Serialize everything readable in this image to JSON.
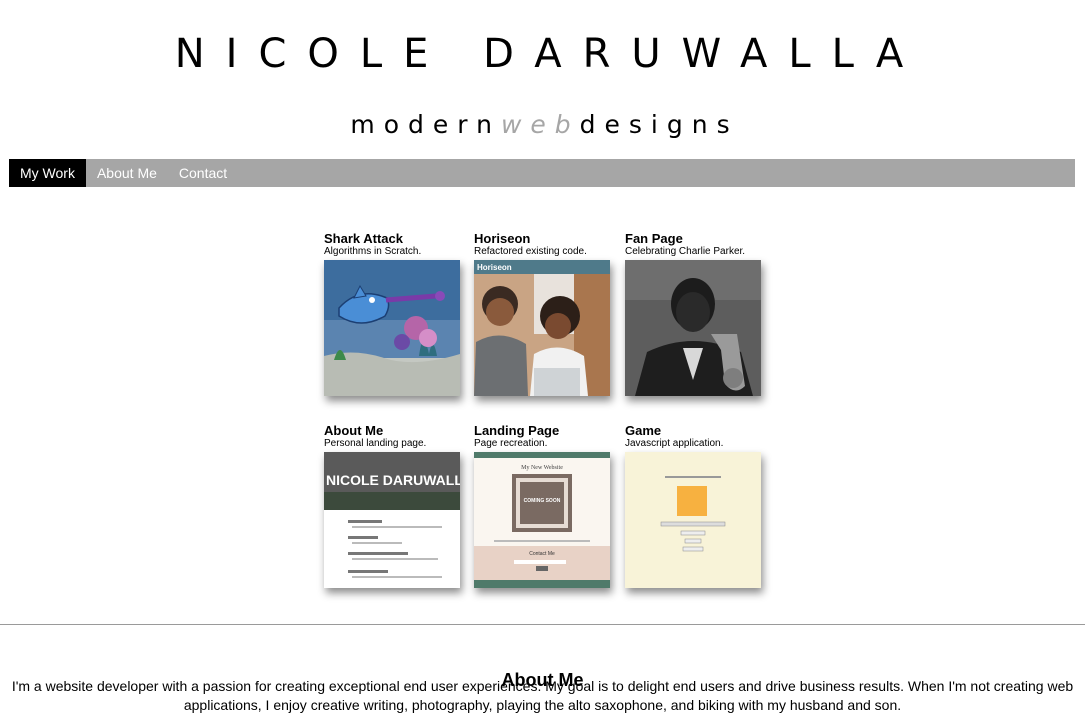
{
  "header": {
    "name": "NICOLE DARUWALLA",
    "tagline_part1": "modern",
    "tagline_part2": "web",
    "tagline_part3": "designs"
  },
  "nav": {
    "items": [
      {
        "label": "My Work",
        "active": true
      },
      {
        "label": "About Me",
        "active": false
      },
      {
        "label": "Contact",
        "active": false
      }
    ]
  },
  "projects": [
    {
      "title": "Shark Attack",
      "desc": "Algorithms in Scratch."
    },
    {
      "title": "Horiseon",
      "desc": "Refactored existing code.",
      "thumb_label": "Horiseon"
    },
    {
      "title": "Fan Page",
      "desc": "Celebrating Charlie Parker."
    },
    {
      "title": "About Me",
      "desc": "Personal landing page.",
      "thumb_label": "NICOLE DARUWALLA"
    },
    {
      "title": "Landing Page",
      "desc": "Page recreation.",
      "thumb_label": "My New Website",
      "thumb_label2": "COMING SOON",
      "thumb_label3": "Contact Me"
    },
    {
      "title": "Game",
      "desc": "Javascript application."
    }
  ],
  "about": {
    "heading": "About Me",
    "line1": "I'm a website developer with a passion for creating exceptional end user experiences. My goal is to delight end users and drive business results. When I'm not creating web",
    "line2": "applications, I enjoy creative writing, photography, playing the alto saxophone, and biking with my husband and son."
  },
  "colors": {
    "nav_bg": "#a6a6a6",
    "nav_active": "#000000",
    "accent_web": "#a6a6a6"
  }
}
